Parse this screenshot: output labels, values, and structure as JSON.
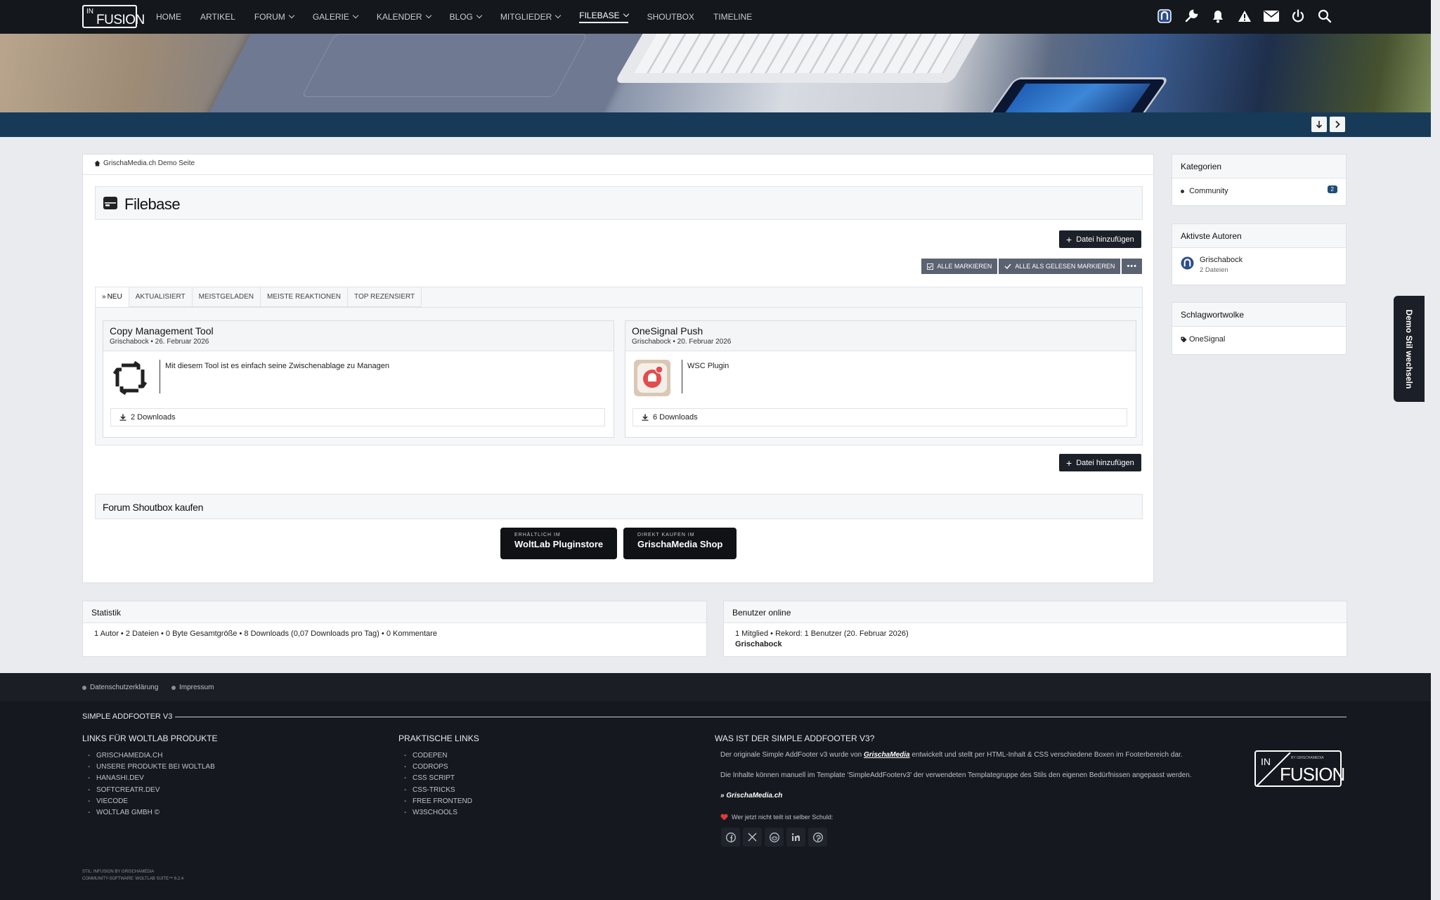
{
  "logo": {
    "in": "IN",
    "fusion": "FUSION"
  },
  "nav": [
    {
      "label": "Home",
      "dropdown": false,
      "active": false
    },
    {
      "label": "Artikel",
      "dropdown": false,
      "active": false
    },
    {
      "label": "Forum",
      "dropdown": true,
      "active": false
    },
    {
      "label": "Galerie",
      "dropdown": true,
      "active": false
    },
    {
      "label": "Kalender",
      "dropdown": true,
      "active": false
    },
    {
      "label": "Blog",
      "dropdown": true,
      "active": false
    },
    {
      "label": "Mitglieder",
      "dropdown": true,
      "active": false
    },
    {
      "label": "Filebase",
      "dropdown": true,
      "active": true
    },
    {
      "label": "Shoutbox",
      "dropdown": false,
      "active": false
    },
    {
      "label": "Timeline",
      "dropdown": false,
      "active": false
    }
  ],
  "top_icons": [
    "user-avatar-icon",
    "wrench-icon",
    "bell-icon",
    "warning-icon",
    "envelope-icon",
    "power-icon",
    "search-icon"
  ],
  "breadcrumb": {
    "label": "GrischaMedia.ch Demo Seite"
  },
  "page": {
    "title": "Filebase"
  },
  "buttons": {
    "add_file": "Datei hinzufügen",
    "mark_all": "Alle markieren",
    "mark_all_read": "Alle als gelesen markieren"
  },
  "tabs": [
    "Neu",
    "Aktualisiert",
    "Meistgeladen",
    "Meiste Reaktionen",
    "Top Rezensiert"
  ],
  "files": [
    {
      "title": "Copy Management Tool",
      "author": "Grischabock",
      "date": "26. Februar 2026",
      "description": "Mit diesem Tool ist es einfach seine Zwischenablage zu Managen",
      "downloads": "2 Downloads"
    },
    {
      "title": "OneSignal Push",
      "author": "Grischabock",
      "date": "20. Februar 2026",
      "description": "WSC Plugin",
      "downloads": "6 Downloads"
    }
  ],
  "shoutbox": {
    "title": "Forum Shoutbox kaufen",
    "store1_small": "ERHÄLTLICH IM",
    "store1_big": "WoltLab Pluginstore",
    "store2_small": "DIREKT KAUFEN IM",
    "store2_big": "GrischaMedia Shop"
  },
  "sidebar": {
    "categories": {
      "title": "Kategorien",
      "item": "Community",
      "count": "2"
    },
    "authors": {
      "title": "Aktivste Autoren",
      "name": "Grischabock",
      "files": "2 Dateien"
    },
    "tags": {
      "title": "Schlagwortwolke",
      "tag": "OneSignal"
    }
  },
  "stats": {
    "title": "Statistik",
    "items": [
      "1 Autor",
      "2 Dateien",
      "0 Byte Gesamtgröße",
      "8 Downloads (0,07 Downloads pro Tag)",
      "0 Kommentare"
    ]
  },
  "online": {
    "title": "Benutzer online",
    "items": [
      "1 Mitglied",
      "Rekord: 1 Benutzer (20. Februar 2026)"
    ],
    "user": "Grischabock"
  },
  "demo_tab": "Demo Stil wechseln",
  "footer": {
    "links": [
      "Datenschutzerklärung",
      "Impressum"
    ],
    "addfooter_title": "SIMPLE ADDFOOTER V3",
    "col1": {
      "title": "LINKS FÜR WOLTLAB PRODUKTE",
      "items": [
        "GRISCHAMEDIA.CH",
        "UNSERE PRODUKTE BEI WOLTLAB",
        "HANASHI.DEV",
        "SOFTCREATR.DEV",
        "VIECODE",
        "WOLTLAB GMBH ©"
      ]
    },
    "col2": {
      "title": "PRAKTISCHE LINKS",
      "items": [
        "CODEPEN",
        "CODROPS",
        "CSS SCRIPT",
        "CSS-TRICKS",
        "FREE FRONTEND",
        "W3SCHOOLS"
      ]
    },
    "col3": {
      "title": "WAS IST DER SIMPLE ADDFOOTER V3?",
      "p1_a": "Der originale Simple AddFooter v3 wurde von",
      "p1_link": "GrischaMedia",
      "p1_b": "entwickelt und stellt per HTML-Inhalt & CSS verschiedene Boxen im Footerbereich dar.",
      "p2": "Die Inhalte können manuell im Template 'SimpleAddFooterv3' der verwendeten Templategruppe des Stils den eigenen Bedürfnissen angepasst werden.",
      "link": "» GrischaMedia.ch",
      "share": "Wer jetzt nicht teilt ist selber Schuld:"
    },
    "logo_small": "BY GRISCHAMEDIA",
    "meta1": "STIL: INFUSION BY GRISCHAMEDIA",
    "meta2": "COMMUNITY-SOFTWARE: WOLTLAB SUITE™ 6.2.4"
  }
}
